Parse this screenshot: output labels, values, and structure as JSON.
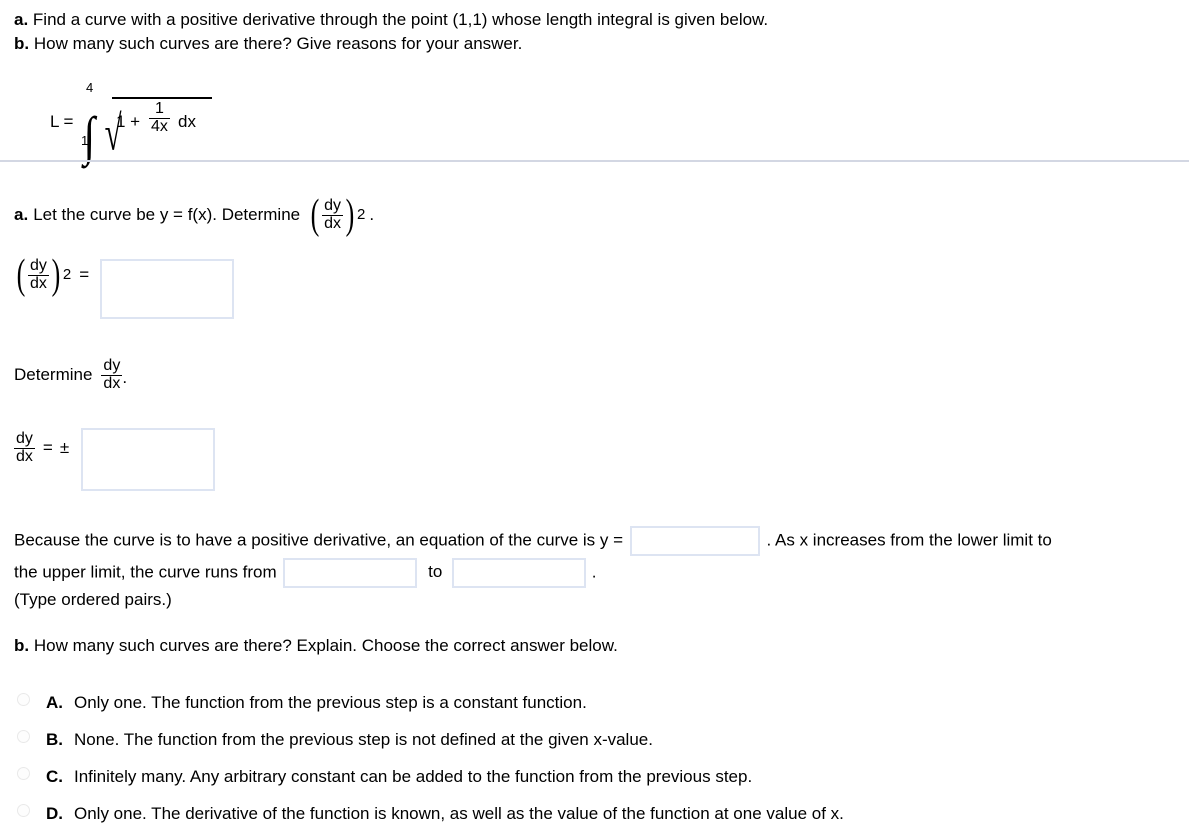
{
  "problem": {
    "part_a_label": "a.",
    "part_a_text": "Find a curve with a positive derivative through the point (1,1) whose length integral is given below.",
    "part_b_label": "b.",
    "part_b_text": "How many such curves are there? Give reasons for your answer.",
    "integral": {
      "lhs": "L =",
      "lower_limit": "1",
      "upper_limit": "4",
      "integrand_one": "1 +",
      "frac_numerator": "1",
      "frac_denominator": "4x",
      "differential": "dx"
    }
  },
  "solution": {
    "step_a_label": "a.",
    "step_a_text_1": "Let the curve be y = f(x). Determine",
    "step_a_math_num": "dy",
    "step_a_math_den": "dx",
    "step_a_exponent": "2",
    "step_a_period": ".",
    "eq1": {
      "num": "dy",
      "den": "dx",
      "exponent": "2",
      "equals": "=",
      "value": ""
    },
    "determine_label": "Determine",
    "determine_num": "dy",
    "determine_den": "dx",
    "determine_period": ".",
    "eq2": {
      "num": "dy",
      "den": "dx",
      "equals": "=",
      "plusminus": "±",
      "value": ""
    },
    "paragraph": {
      "line1_before": "Because the curve is to have a positive derivative, an equation of the curve is y =",
      "curve_value": "",
      "line1_after": ". As x increases from the lower limit to",
      "line2_before": "the upper limit, the curve runs from",
      "from_value": "",
      "line2_middle": "to",
      "to_value": "",
      "line2_after": ".",
      "line3": "(Type ordered pairs.)"
    }
  },
  "question_b": {
    "label": "b.",
    "text": "How many such curves are there? Explain. Choose the correct answer below.",
    "options": [
      {
        "letter": "A.",
        "text": "Only one. The function from the previous step is a constant function."
      },
      {
        "letter": "B.",
        "text": "None. The function from the previous step is not defined at the given x-value."
      },
      {
        "letter": "C.",
        "text": "Infinitely many. Any arbitrary constant can be added to the function from the previous step."
      },
      {
        "letter": "D.",
        "text": "Only one. The derivative of the function is known, as well as the value of the function at one value of x."
      }
    ]
  },
  "colors": {
    "input_border": "#dde4f2",
    "divider": "#d3d7e3",
    "text": "#000000"
  }
}
